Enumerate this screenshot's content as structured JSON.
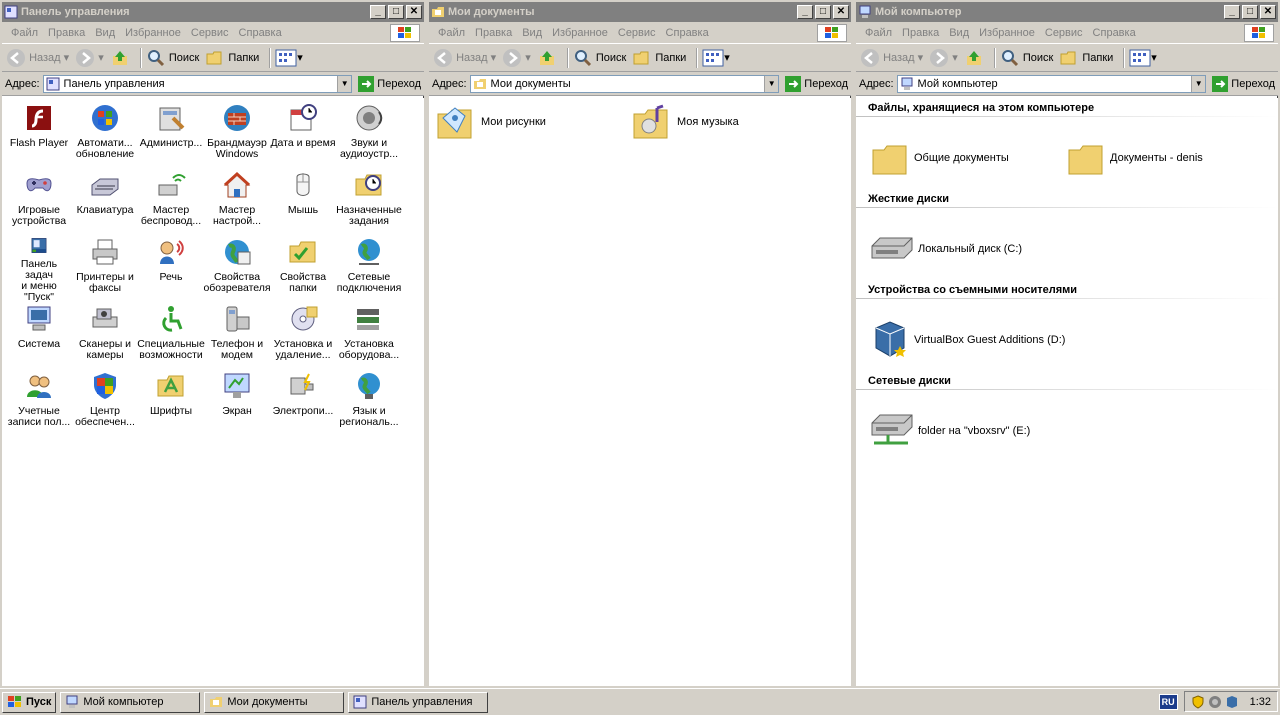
{
  "common": {
    "menu": [
      "Файл",
      "Правка",
      "Вид",
      "Избранное",
      "Сервис",
      "Справка"
    ],
    "back": "Назад",
    "search": "Поиск",
    "folders": "Папки",
    "address_label": "Адрес:",
    "go": "Переход"
  },
  "control_panel": {
    "title": "Панель управления",
    "address": "Панель управления",
    "items": [
      {
        "line1": "Flash Player",
        "line2": "",
        "icon": "flash-player-icon"
      },
      {
        "line1": "Автомати...",
        "line2": "обновление",
        "icon": "windows-update-icon"
      },
      {
        "line1": "Администр...",
        "line2": "",
        "icon": "admin-tools-icon"
      },
      {
        "line1": "Брандмауэр",
        "line2": "Windows",
        "icon": "firewall-icon"
      },
      {
        "line1": "Дата и время",
        "line2": "",
        "icon": "date-time-icon"
      },
      {
        "line1": "Звуки и",
        "line2": "аудиоустр...",
        "icon": "sounds-icon"
      },
      {
        "line1": "Игровые",
        "line2": "устройства",
        "icon": "game-controller-icon"
      },
      {
        "line1": "Клавиатура",
        "line2": "",
        "icon": "keyboard-icon"
      },
      {
        "line1": "Мастер",
        "line2": "беспровод...",
        "icon": "wireless-wizard-icon"
      },
      {
        "line1": "Мастер",
        "line2": "настрой...",
        "icon": "network-wizard-icon"
      },
      {
        "line1": "Мышь",
        "line2": "",
        "icon": "mouse-icon"
      },
      {
        "line1": "Назначенные",
        "line2": "задания",
        "icon": "scheduled-tasks-icon"
      },
      {
        "line1": "Панель задач",
        "line2": "и меню \"Пуск\"",
        "icon": "taskbar-icon"
      },
      {
        "line1": "Принтеры и",
        "line2": "факсы",
        "icon": "printer-icon"
      },
      {
        "line1": "Речь",
        "line2": "",
        "icon": "speech-icon"
      },
      {
        "line1": "Свойства",
        "line2": "обозревателя",
        "icon": "internet-options-icon"
      },
      {
        "line1": "Свойства",
        "line2": "папки",
        "icon": "folder-options-icon"
      },
      {
        "line1": "Сетевые",
        "line2": "подключения",
        "icon": "network-connections-icon"
      },
      {
        "line1": "Система",
        "line2": "",
        "icon": "system-icon"
      },
      {
        "line1": "Сканеры и",
        "line2": "камеры",
        "icon": "scanner-icon"
      },
      {
        "line1": "Специальные",
        "line2": "возможности",
        "icon": "accessibility-icon"
      },
      {
        "line1": "Телефон и",
        "line2": "модем",
        "icon": "phone-modem-icon"
      },
      {
        "line1": "Установка и",
        "line2": "удаление...",
        "icon": "add-remove-programs-icon"
      },
      {
        "line1": "Установка",
        "line2": "оборудова...",
        "icon": "add-hardware-icon"
      },
      {
        "line1": "Учетные",
        "line2": "записи пол...",
        "icon": "user-accounts-icon"
      },
      {
        "line1": "Центр",
        "line2": "обеспечен...",
        "icon": "security-center-icon"
      },
      {
        "line1": "Шрифты",
        "line2": "",
        "icon": "fonts-icon"
      },
      {
        "line1": "Экран",
        "line2": "",
        "icon": "display-icon"
      },
      {
        "line1": "Электропи...",
        "line2": "",
        "icon": "power-options-icon"
      },
      {
        "line1": "Язык и",
        "line2": "региональ...",
        "icon": "regional-options-icon"
      }
    ]
  },
  "my_documents": {
    "title": "Мои документы",
    "address": "Мои документы",
    "items": [
      {
        "label": "Мои рисунки",
        "icon": "my-pictures-folder-icon"
      },
      {
        "label": "Моя музыка",
        "icon": "my-music-folder-icon"
      }
    ]
  },
  "my_computer": {
    "title": "Мой компьютер",
    "address": "Мой компьютер",
    "sections": [
      {
        "heading": "Файлы, хранящиеся на этом компьютере",
        "items": [
          {
            "label": "Общие документы",
            "icon": "folder-icon"
          },
          {
            "label": "Документы - denis",
            "icon": "folder-icon"
          }
        ]
      },
      {
        "heading": "Жесткие диски",
        "items": [
          {
            "label": "Локальный диск (C:)",
            "icon": "hard-drive-icon"
          }
        ]
      },
      {
        "heading": "Устройства со съемными носителями",
        "items": [
          {
            "label": "VirtualBox Guest Additions (D:)",
            "icon": "cd-drive-icon"
          }
        ]
      },
      {
        "heading": "Сетевые диски",
        "items": [
          {
            "label": "folder на \"vboxsrv\" (E:)",
            "icon": "network-drive-icon"
          }
        ]
      }
    ]
  },
  "taskbar": {
    "start": "Пуск",
    "buttons": [
      "Мой компьютер",
      "Мои документы",
      "Панель управления"
    ],
    "lang": "RU",
    "clock": "1:32"
  }
}
